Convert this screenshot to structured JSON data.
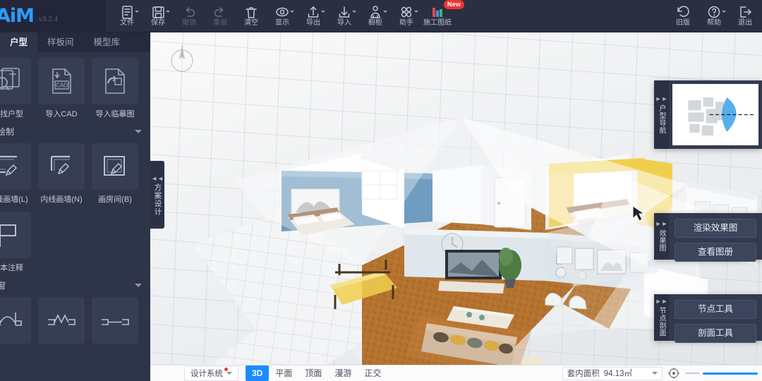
{
  "app": {
    "logo_text": "AiM",
    "version": "v3.2.4"
  },
  "toolbar": {
    "items": [
      {
        "label": "文件",
        "icon": "file-icon",
        "disabled": false,
        "caret": true
      },
      {
        "label": "保存",
        "icon": "save-icon",
        "disabled": false,
        "caret": true
      },
      {
        "label": "撤销",
        "icon": "undo-icon",
        "disabled": true,
        "caret": false
      },
      {
        "label": "重做",
        "icon": "redo-icon",
        "disabled": true,
        "caret": false
      },
      {
        "label": "清空",
        "icon": "trash-icon",
        "disabled": false,
        "caret": false
      },
      {
        "label": "显示",
        "icon": "eye-icon",
        "disabled": false,
        "caret": true
      },
      {
        "label": "导出",
        "icon": "export-icon",
        "disabled": false,
        "caret": true
      },
      {
        "label": "导入",
        "icon": "import-icon",
        "disabled": false,
        "caret": true
      },
      {
        "label": "橱柜",
        "icon": "cabinet-icon",
        "disabled": false,
        "caret": true
      },
      {
        "label": "助手",
        "icon": "assistant-icon",
        "disabled": false,
        "caret": true
      },
      {
        "label": "施工图纸",
        "icon": "blueprint-icon",
        "disabled": false,
        "caret": false,
        "badge": "New"
      }
    ],
    "right_items": [
      {
        "label": "旧版",
        "icon": "revert-icon"
      },
      {
        "label": "帮助",
        "icon": "help-icon",
        "caret": true
      },
      {
        "label": "退出",
        "icon": "exit-icon"
      }
    ]
  },
  "panel_tabs": [
    {
      "label": "户型",
      "active": true
    },
    {
      "label": "样板间",
      "active": false
    },
    {
      "label": "模型库",
      "active": false
    }
  ],
  "left_panel": {
    "group1": {
      "tools": [
        {
          "label": "查找户型",
          "icon": "search-plan-icon"
        },
        {
          "label": "导入CAD",
          "icon": "cad-file-icon"
        },
        {
          "label": "导入临摹图",
          "icon": "trace-image-icon"
        }
      ],
      "section_label": "绘制"
    },
    "group2": {
      "tools": [
        {
          "label": "外线画墙(L)",
          "icon": "outer-wall-icon"
        },
        {
          "label": "内线画墙(N)",
          "icon": "inner-wall-icon"
        },
        {
          "label": "画房间(B)",
          "icon": "draw-room-icon"
        }
      ]
    },
    "group3": {
      "tools": [
        {
          "label": "文本注释",
          "icon": "flag-annotation-icon"
        }
      ],
      "section_label": "窗"
    },
    "group4": {
      "tools": [
        {
          "label": "",
          "icon": "bay-window-icon"
        },
        {
          "label": "",
          "icon": "double-window-icon"
        },
        {
          "label": "",
          "icon": "flat-window-icon"
        }
      ]
    }
  },
  "side_tab": {
    "label": "方案设计",
    "arrows": "◄◄"
  },
  "right_panels": [
    {
      "tab_label": "户型导航",
      "arrows": "►►",
      "type": "minimap"
    },
    {
      "tab_label": "效果图",
      "arrows": "►►",
      "buttons": [
        "渲染效果图",
        "查看图册"
      ]
    },
    {
      "tab_label": "节点剖面",
      "arrows": "►►",
      "buttons": [
        "节点工具",
        "剖面工具"
      ]
    }
  ],
  "status_bar": {
    "design_system_label": "设计系统",
    "view_modes": [
      {
        "label": "3D",
        "active": true
      },
      {
        "label": "平面",
        "active": false
      },
      {
        "label": "顶面",
        "active": false
      },
      {
        "label": "漫游",
        "active": false
      },
      {
        "label": "正交",
        "active": false
      }
    ],
    "area_label": "套内面积",
    "area_value": "94.13㎡",
    "zoom_icon": "zoom-target-icon"
  },
  "viewport": {
    "compass_icon": "compass-north-icon",
    "scene_description": "3D isometric apartment floor plan"
  },
  "colors": {
    "accent": "#1a8cff",
    "logo": "#2f9bff",
    "badge": "#f03434",
    "panel_bg": "#2f3548",
    "topbar_bg": "#2a2f42",
    "bedroom_wall": "#6f9cbf",
    "kitchen_accent": "#f0cf4e",
    "floor_wood": "#b5732e"
  }
}
